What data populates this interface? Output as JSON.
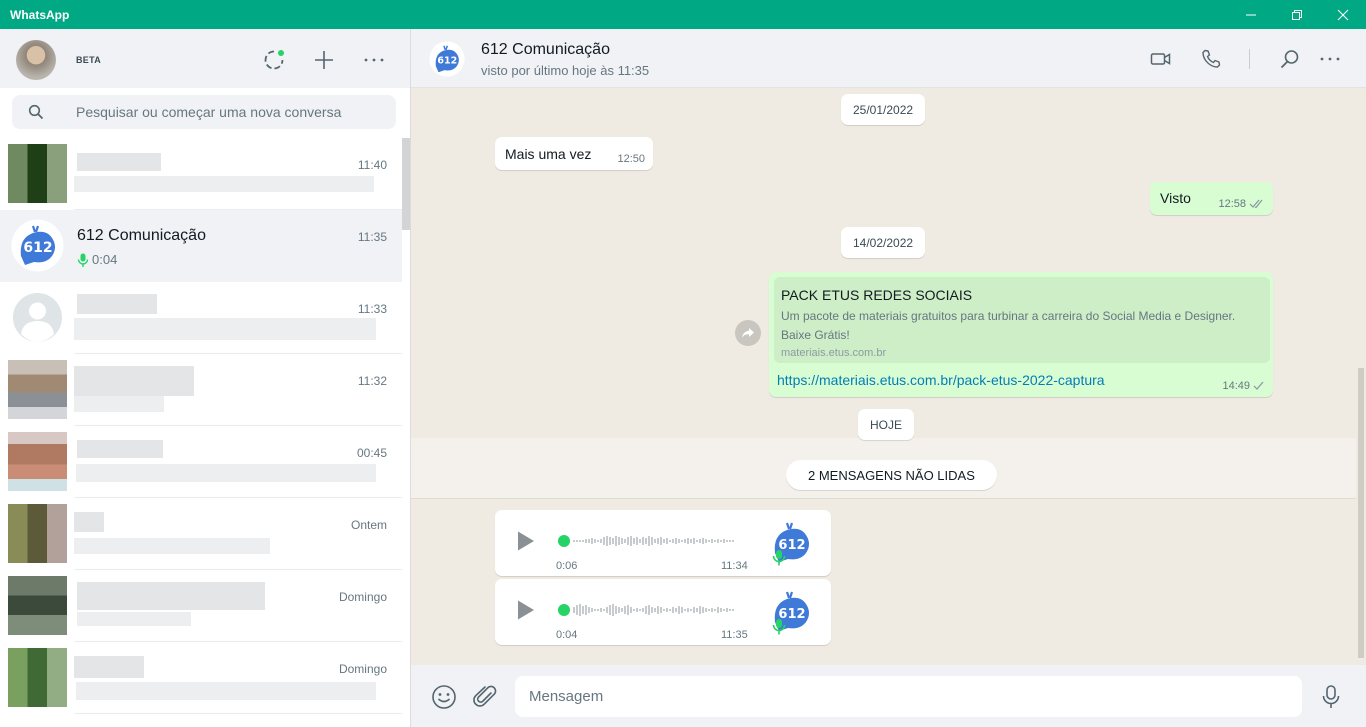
{
  "window": {
    "title": "WhatsApp",
    "controls": [
      "minimize-icon",
      "restore-icon",
      "close-icon"
    ]
  },
  "colors": {
    "titlebar": "#00a884",
    "outgoing_bubble": "#d9fdd3",
    "link": "#027eb5",
    "online_dot": "#25d366",
    "brand_blue": "#3f7ad8"
  },
  "sidebar": {
    "badge": "BETA",
    "header_icons": [
      "status-icon",
      "new-chat-icon",
      "menu-icon"
    ],
    "search": {
      "placeholder": "Pesquisar ou começar uma nova conversa"
    },
    "chats": [
      {
        "name": "",
        "time": "11:40",
        "preview": "",
        "blurred": true
      },
      {
        "name": "612 Comunicação",
        "time": "11:35",
        "preview": "0:04",
        "blurred": false,
        "active": true
      },
      {
        "name": "",
        "time": "11:33",
        "preview": "",
        "blurred": true
      },
      {
        "name": "",
        "time": "11:32",
        "preview": "",
        "blurred": true
      },
      {
        "name": "",
        "time": "00:45",
        "preview": "",
        "blurred": true
      },
      {
        "name": "",
        "time": "Ontem",
        "preview": "",
        "blurred": true
      },
      {
        "name": "",
        "time": "Domingo",
        "preview": "",
        "blurred": true
      },
      {
        "name": "",
        "time": "Domingo",
        "preview": "",
        "blurred": true
      }
    ]
  },
  "conversation": {
    "name": "612 Comunicação",
    "status": "visto por último hoje às 11:35",
    "header_icons": [
      "video-call-icon",
      "voice-call-icon",
      "search-icon",
      "menu-icon"
    ],
    "avatar_label": "612",
    "items": [
      {
        "kind": "date",
        "text": "25/01/2022"
      },
      {
        "kind": "in",
        "text": "Mais uma vez",
        "time": "12:50"
      },
      {
        "kind": "out",
        "text": "Visto",
        "time": "12:58",
        "ticks": "read"
      },
      {
        "kind": "date",
        "text": "14/02/2022"
      },
      {
        "kind": "out-link",
        "preview_title": "PACK ETUS REDES SOCIAIS",
        "preview_desc_1": "Um pacote de materiais gratuitos para turbinar a carreira do Social Media e Designer.",
        "preview_desc_2": "Baixe Grátis!",
        "preview_domain": "materiais.etus.com.br",
        "url": "https://materiais.etus.com.br/pack-etus-2022-captura",
        "time": "14:49",
        "ticks": "sent"
      },
      {
        "kind": "date",
        "text": "HOJE"
      },
      {
        "kind": "unread",
        "text": "2 MENSAGENS NÃO LIDAS"
      },
      {
        "kind": "voice",
        "duration": "0:06",
        "time": "11:34"
      },
      {
        "kind": "voice",
        "duration": "0:04",
        "time": "11:35"
      }
    ]
  },
  "composer": {
    "placeholder": "Mensagem",
    "icons": [
      "emoji-icon",
      "attach-icon",
      "microphone-icon"
    ]
  }
}
